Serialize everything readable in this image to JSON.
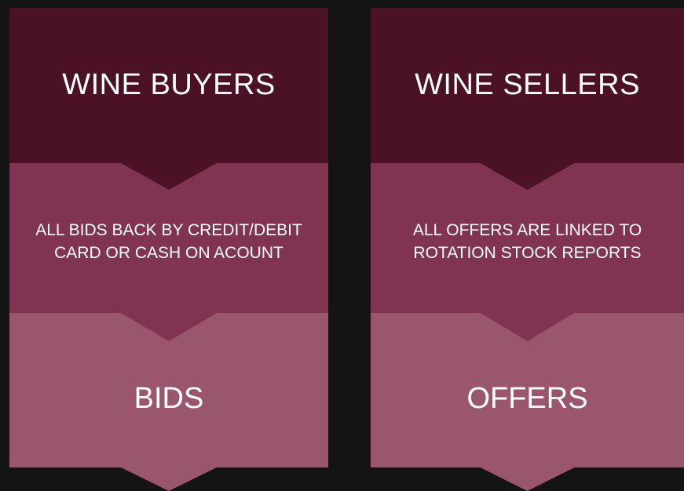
{
  "columns": [
    {
      "title": "WINE BUYERS",
      "description_line1": "ALL BIDS BACK BY CREDIT/DEBIT",
      "description_line2": "CARD OR CASH ON ACOUNT",
      "result": "BIDS"
    },
    {
      "title": "WINE SELLERS",
      "description_line1": "ALL OFFERS ARE LINKED TO",
      "description_line2": "ROTATION STOCK REPORTS",
      "result": "OFFERS"
    }
  ],
  "colors": {
    "background": "#141414",
    "top_band": "#4b1124",
    "middle_band": "#803451",
    "bottom_band": "#99566d",
    "text": "#ffffff"
  }
}
